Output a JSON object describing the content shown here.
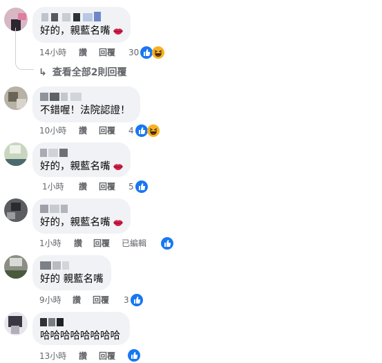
{
  "comments": [
    {
      "text": "好的，親藍名嘴",
      "time": "14小時",
      "like": "讚",
      "reply": "回覆",
      "reaction_count": "30",
      "reactions": [
        "like-icon",
        "haha-icon"
      ]
    },
    {
      "text": "不錯喔！法院認證！",
      "time": "10小時",
      "like": "讚",
      "reply": "回覆",
      "reaction_count": "4",
      "reactions": [
        "like-icon",
        "haha-icon"
      ]
    },
    {
      "text": "好的，親藍名嘴",
      "time": "1小時",
      "like": "讚",
      "reply": "回覆",
      "reaction_count": "5",
      "reactions": [
        "like-icon"
      ]
    },
    {
      "text": "好的，親藍名嘴",
      "time": "1小時",
      "like": "讚",
      "reply": "回覆",
      "edited": "已編輯",
      "reaction_count": "",
      "reactions": [
        "like-icon"
      ]
    },
    {
      "text": "好的 親藍名嘴",
      "time": "9小時",
      "like": "讚",
      "reply": "回覆",
      "reaction_count": "3",
      "reactions": [
        "like-icon"
      ]
    },
    {
      "text": "哈哈哈哈哈哈哈哈",
      "time": "13小時",
      "like": "讚",
      "reply": "回覆",
      "reaction_count": "",
      "reactions": [
        "like-icon"
      ]
    }
  ],
  "view_replies": {
    "arrow": "↳",
    "label": "查看全部2則回覆"
  },
  "colors": {
    "bubble": "#f0f2f5",
    "meta": "#65676b",
    "like_blue": "#1877f2",
    "haha_yellow": "#f7b125"
  }
}
